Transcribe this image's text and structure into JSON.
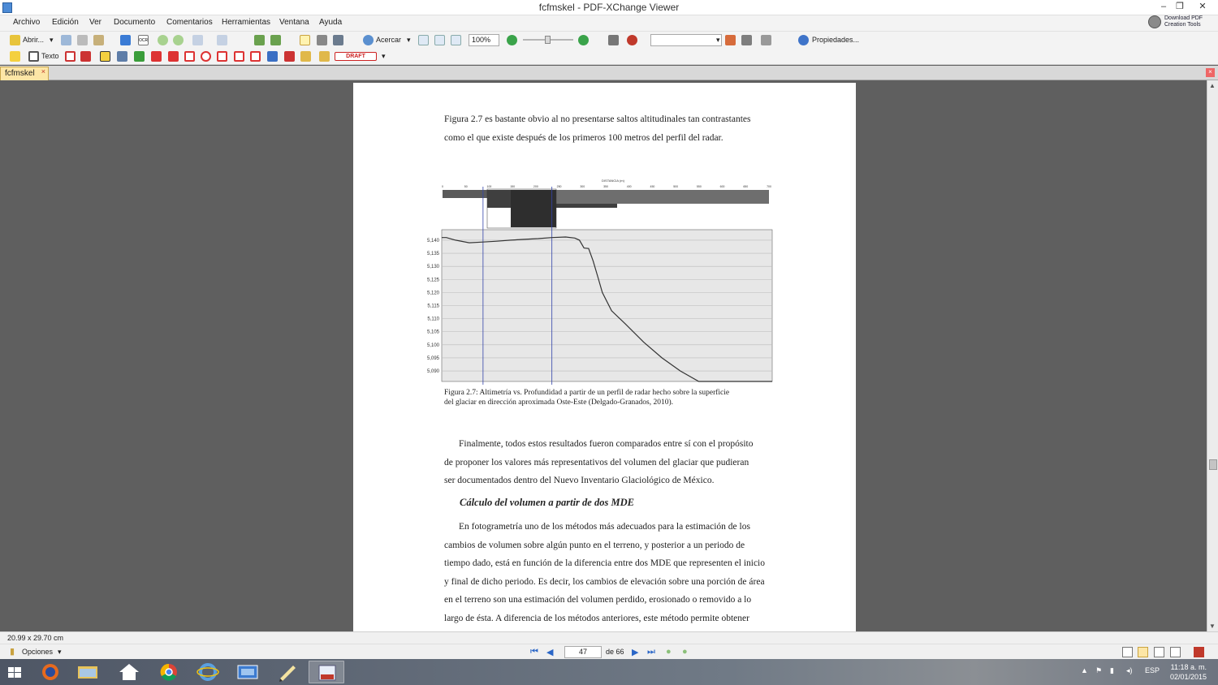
{
  "window": {
    "title": "fcfmskel - PDF-XChange Viewer",
    "minimize": "–",
    "restore": "❐",
    "close": "✕"
  },
  "menu": [
    "Archivo",
    "Edición",
    "Ver",
    "Documento",
    "Comentarios",
    "Herramientas",
    "Ventana",
    "Ayuda"
  ],
  "download_badge": {
    "line1": "Download PDF",
    "line2": "Creation Tools"
  },
  "toolbar1": {
    "open_label": "Abrir...",
    "zoom_in_label": "Acercar",
    "zoom_value": "100%",
    "properties_label": "Propiedades...",
    "ocr_label": "OCR"
  },
  "toolbar2": {
    "text_label": "Texto",
    "stamp_label": "DRAFT"
  },
  "tab": {
    "label": "fcfmskel",
    "close": "×"
  },
  "document": {
    "para1_l1": "Figura 2.7 es bastante obvio al no presentarse saltos altitudinales tan contrastantes",
    "para1_l2": "como el que existe después de los primeros 100 metros del perfil del radar.",
    "caption_l1": "Figura 2.7: Altimetría vs. Profundidad a partir de un perfil de radar hecho sobre la superficie",
    "caption_l2": "del glaciar en dirección aproximada Oste-Este (Delgado-Granados, 2010).",
    "para2_l1": "Finalmente, todos estos resultados fueron comparados entre sí con el propósito",
    "para2_l2": "de proponer los valores más representativos del volumen del glaciar que pudieran",
    "para2_l3": "ser documentados dentro del Nuevo Inventario Glaciológico de México.",
    "heading": "Cálculo del volumen a partir de dos MDE",
    "para3_l1": "En fotogrametría uno de los métodos más adecuados para la estimación de los",
    "para3_l2": "cambios de volumen sobre algún punto en el terreno, y posterior a un periodo de",
    "para3_l3": "tiempo dado, está en función de la diferencia entre dos MDE que representen el inicio",
    "para3_l4": "y final de dicho periodo. Es decir, los cambios de elevación sobre una porción de área",
    "para3_l5": "en el terreno son una estimación del volumen perdido, erosionado o removido a lo",
    "para3_l6": "largo de ésta. A diferencia de los métodos anteriores, este método permite obtener"
  },
  "chart_data": {
    "type": "line",
    "title": "",
    "radar_header": "DISTANCIA (m)",
    "radar_ticks": [
      "0",
      "50",
      "100",
      "150",
      "200",
      "250",
      "300",
      "350",
      "400",
      "450",
      "500",
      "550",
      "600",
      "650",
      "700"
    ],
    "y_ticks": [
      "5,140",
      "5,135",
      "5,130",
      "5,125",
      "5,120",
      "5,115",
      "5,110",
      "5,105",
      "5,100",
      "5,095",
      "5,090"
    ],
    "ylim": [
      5086,
      5144
    ],
    "xlim": [
      0,
      720
    ],
    "x": [
      0,
      10,
      30,
      60,
      90,
      120,
      150,
      180,
      210,
      240,
      270,
      290,
      300,
      310,
      320,
      330,
      340,
      350,
      370,
      400,
      440,
      480,
      520,
      560,
      600,
      640,
      670,
      700,
      720
    ],
    "y": [
      5141,
      5141,
      5140,
      5139,
      5139.3,
      5139.6,
      5140,
      5140.3,
      5140.6,
      5141,
      5141.2,
      5140.8,
      5140,
      5137,
      5136.8,
      5132,
      5126,
      5120,
      5113,
      5108,
      5101,
      5095,
      5090,
      5086,
      5086,
      5086,
      5086,
      5086,
      5086
    ],
    "vertical_lines_x": [
      90,
      240
    ],
    "grid": true
  },
  "status": {
    "dimensions": "20.99 x 29.70 cm",
    "options": "Opciones"
  },
  "navigation": {
    "current_page": "47",
    "of_label": "de 66"
  },
  "taskbar": {
    "lang": "ESP",
    "time": "11:18 a. m.",
    "date": "02/01/2015"
  }
}
